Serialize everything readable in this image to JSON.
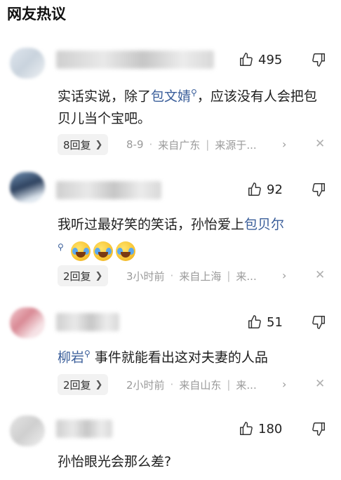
{
  "section_title": "网友热议",
  "comments": [
    {
      "likes": "495",
      "text_before": "实话实说，除了",
      "link_text": "包文婧",
      "text_after": "，应该没有人会把包贝儿当个宝吧。",
      "reply_label": "8回复",
      "date": "8-9",
      "location": "来自广东",
      "source": "来源于..."
    },
    {
      "likes": "92",
      "text_before": "我听过最好笑的笑话，孙怡爱上",
      "link_text": "包贝尔",
      "text_after": "",
      "emojis": [
        "cry-laugh-emoji",
        "cry-laugh-emoji",
        "cry-laugh-emoji"
      ],
      "reply_label": "2回复",
      "time": "3小时前",
      "location": "来自上海",
      "more": "来..."
    },
    {
      "likes": "51",
      "link_text": "柳岩",
      "text_after": "事件就能看出这对夫妻的人品",
      "reply_label": "2回复",
      "time": "2小时前",
      "location": "来自山东",
      "more": "来..."
    },
    {
      "likes": "180",
      "text": "孙怡眼光会那么差?"
    }
  ]
}
